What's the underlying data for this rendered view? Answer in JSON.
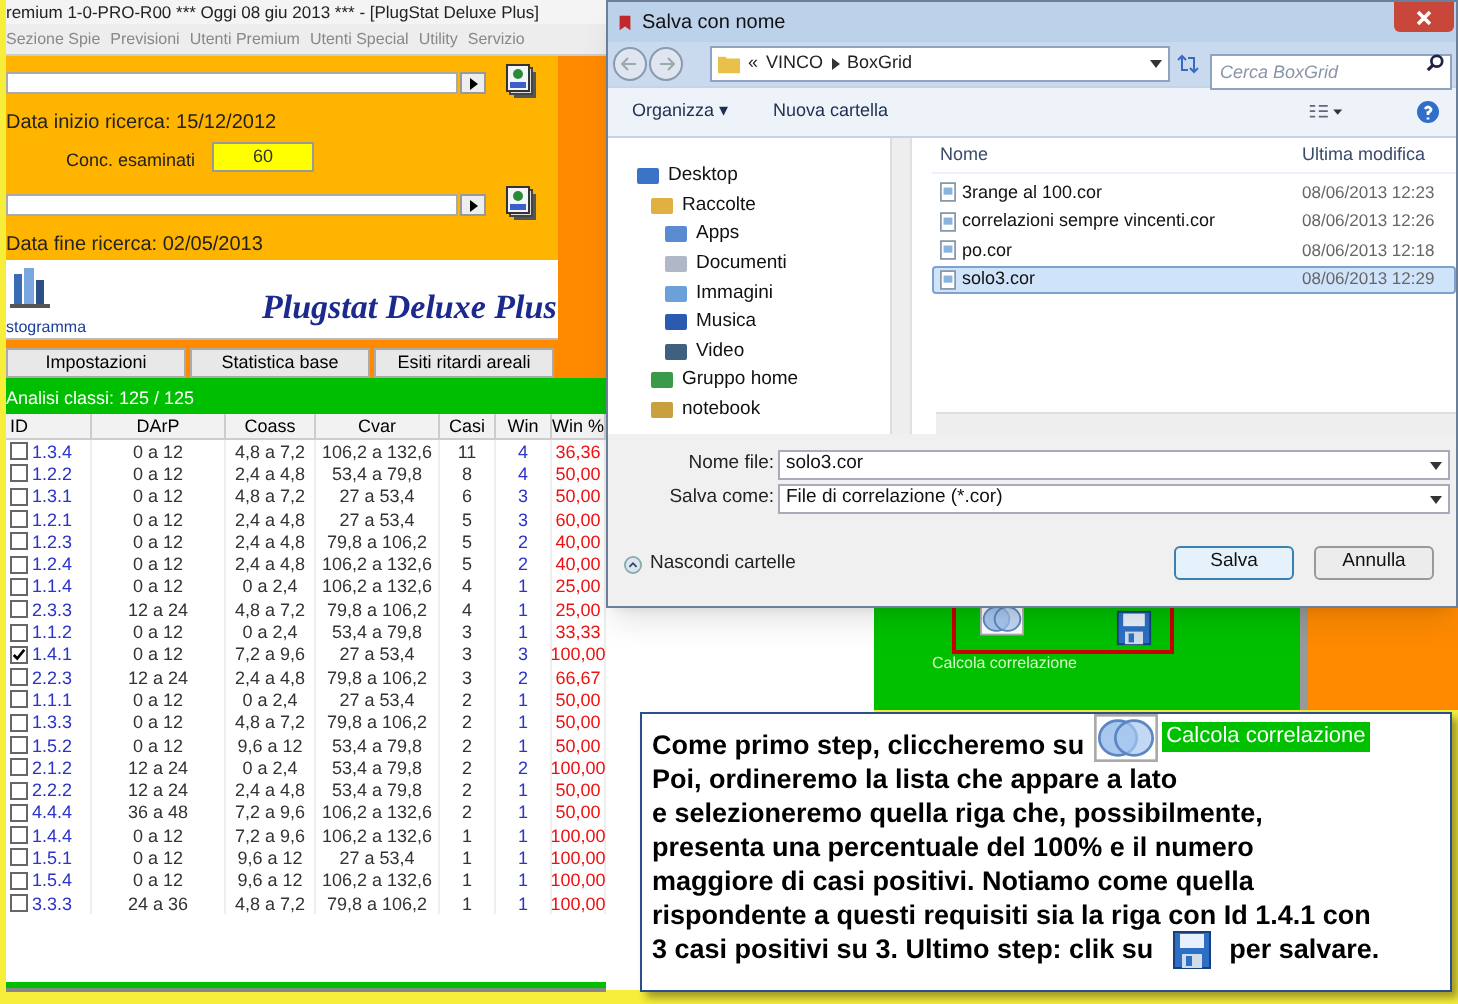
{
  "app": {
    "title": "remium 1-0-PRO-R00 *** Oggi 08 giu 2013 *** - [PlugStat Deluxe Plus]",
    "menu": [
      "Sezione Spie",
      "Previsioni",
      "Utenti Premium",
      "Utenti Special",
      "Utility",
      "Servizio"
    ],
    "start_label": "Data inizio ricerca: 15/12/2012",
    "conc_label": "Conc. esaminati",
    "conc_value": "60",
    "end_label": "Data fine ricerca: 02/05/2013",
    "histogram_label": "stogramma",
    "brand": "Plugstat Deluxe Plus",
    "tabs": [
      "Impostazioni",
      "Statistica base",
      "Esiti ritardi areali"
    ],
    "analysis_label": "Analisi classi: 125 / 125",
    "table": {
      "columns": [
        "ID",
        "DArP",
        "Coass",
        "Cvar",
        "Casi",
        "Win",
        "Win %"
      ],
      "rows": [
        {
          "checked": false,
          "cells": [
            "1.3.4",
            "0 a 12",
            "4,8 a 7,2",
            "106,2 a 132,6",
            "11",
            "4",
            "36,36"
          ]
        },
        {
          "checked": false,
          "cells": [
            "1.2.2",
            "0 a 12",
            "2,4 a 4,8",
            "53,4 a 79,8",
            "8",
            "4",
            "50,00"
          ]
        },
        {
          "checked": false,
          "cells": [
            "1.3.1",
            "0 a 12",
            "4,8 a 7,2",
            "27 a 53,4",
            "6",
            "3",
            "50,00"
          ]
        },
        {
          "checked": false,
          "cells": [
            "1.2.1",
            "0 a 12",
            "2,4 a 4,8",
            "27 a 53,4",
            "5",
            "3",
            "60,00"
          ]
        },
        {
          "checked": false,
          "cells": [
            "1.2.3",
            "0 a 12",
            "2,4 a 4,8",
            "79,8 a 106,2",
            "5",
            "2",
            "40,00"
          ]
        },
        {
          "checked": false,
          "cells": [
            "1.2.4",
            "0 a 12",
            "2,4 a 4,8",
            "106,2 a 132,6",
            "5",
            "2",
            "40,00"
          ]
        },
        {
          "checked": false,
          "cells": [
            "1.1.4",
            "0 a 12",
            "0 a 2,4",
            "106,2 a 132,6",
            "4",
            "1",
            "25,00"
          ]
        },
        {
          "checked": false,
          "cells": [
            "2.3.3",
            "12 a 24",
            "4,8 a 7,2",
            "79,8 a 106,2",
            "4",
            "1",
            "25,00"
          ]
        },
        {
          "checked": false,
          "cells": [
            "1.1.2",
            "0 a 12",
            "0 a 2,4",
            "53,4 a 79,8",
            "3",
            "1",
            "33,33"
          ]
        },
        {
          "checked": true,
          "cells": [
            "1.4.1",
            "0 a 12",
            "7,2 a 9,6",
            "27 a 53,4",
            "3",
            "3",
            "100,00"
          ]
        },
        {
          "checked": false,
          "cells": [
            "2.2.3",
            "12 a 24",
            "2,4 a 4,8",
            "79,8 a 106,2",
            "3",
            "2",
            "66,67"
          ]
        },
        {
          "checked": false,
          "cells": [
            "1.1.1",
            "0 a 12",
            "0 a 2,4",
            "27 a 53,4",
            "2",
            "1",
            "50,00"
          ]
        },
        {
          "checked": false,
          "cells": [
            "1.3.3",
            "0 a 12",
            "4,8 a 7,2",
            "79,8 a 106,2",
            "2",
            "1",
            "50,00"
          ]
        },
        {
          "checked": false,
          "cells": [
            "1.5.2",
            "0 a 12",
            "9,6 a 12",
            "53,4 a 79,8",
            "2",
            "1",
            "50,00"
          ]
        },
        {
          "checked": false,
          "cells": [
            "2.1.2",
            "12 a 24",
            "0 a 2,4",
            "53,4 a 79,8",
            "2",
            "2",
            "100,00"
          ]
        },
        {
          "checked": false,
          "cells": [
            "2.2.2",
            "12 a 24",
            "2,4 a 4,8",
            "53,4 a 79,8",
            "2",
            "1",
            "50,00"
          ]
        },
        {
          "checked": false,
          "cells": [
            "4.4.4",
            "36 a 48",
            "7,2 a 9,6",
            "106,2 a 132,6",
            "2",
            "1",
            "50,00"
          ]
        },
        {
          "checked": false,
          "cells": [
            "1.4.4",
            "0 a 12",
            "7,2 a 9,6",
            "106,2 a 132,6",
            "1",
            "1",
            "100,00"
          ]
        },
        {
          "checked": false,
          "cells": [
            "1.5.1",
            "0 a 12",
            "9,6 a 12",
            "27 a 53,4",
            "1",
            "1",
            "100,00"
          ]
        },
        {
          "checked": false,
          "cells": [
            "1.5.4",
            "0 a 12",
            "9,6 a 12",
            "106,2 a 132,6",
            "1",
            "1",
            "100,00"
          ]
        },
        {
          "checked": false,
          "cells": [
            "3.3.3",
            "24 a 36",
            "4,8 a 7,2",
            "79,8 a 106,2",
            "1",
            "1",
            "100,00"
          ]
        }
      ]
    },
    "correlation_label": "Calcola correlazione"
  },
  "dialog": {
    "title": "Salva con nome",
    "path_prefix": "«",
    "path": [
      "VINCO",
      "BoxGrid"
    ],
    "search": {
      "placeholder": "Cerca BoxGrid"
    },
    "toolbar": [
      "Organizza ▾",
      "Nuova cartella"
    ],
    "tree": [
      {
        "label": "Desktop",
        "children": [
          {
            "label": "Raccolte",
            "children": [
              {
                "label": "Apps"
              },
              {
                "label": "Documenti"
              },
              {
                "label": "Immagini"
              },
              {
                "label": "Musica"
              },
              {
                "label": "Video"
              }
            ]
          },
          {
            "label": "Gruppo home"
          },
          {
            "label": "notebook"
          }
        ]
      }
    ],
    "columns": [
      "Nome",
      "Ultima modifica"
    ],
    "files": [
      {
        "name": "3range al 100.cor",
        "modified": "08/06/2013 12:23",
        "selected": false
      },
      {
        "name": "correlazioni sempre vincenti.cor",
        "modified": "08/06/2013 12:26",
        "selected": false
      },
      {
        "name": "po.cor",
        "modified": "08/06/2013 12:18",
        "selected": false
      },
      {
        "name": "solo3.cor",
        "modified": "08/06/2013 12:29",
        "selected": true
      }
    ],
    "fields": [
      {
        "label": "Nome file:",
        "value": "solo3.cor"
      },
      {
        "label": "Salva come:",
        "value": "File di correlazione (*.cor)"
      }
    ],
    "hide_folders": "Nascondi cartelle",
    "buttons": [
      "Salva",
      "Annulla"
    ]
  },
  "callout": {
    "first_line": "Come primo step, cliccheremo su",
    "badge": "Calcola correlazione",
    "lines": [
      "Poi, ordineremo la lista che appare a lato",
      "e selezioneremo quella riga che, possibilmente,",
      "presenta una percentuale del 100% e il numero",
      "maggiore di casi positivi. Notiamo come quella",
      "rispondente a questi requisiti sia la riga con Id 1.4.1 con"
    ],
    "last_line": "3 casi positivi su 3. Ultimo step: clik su",
    "last_end": "per salvare."
  }
}
